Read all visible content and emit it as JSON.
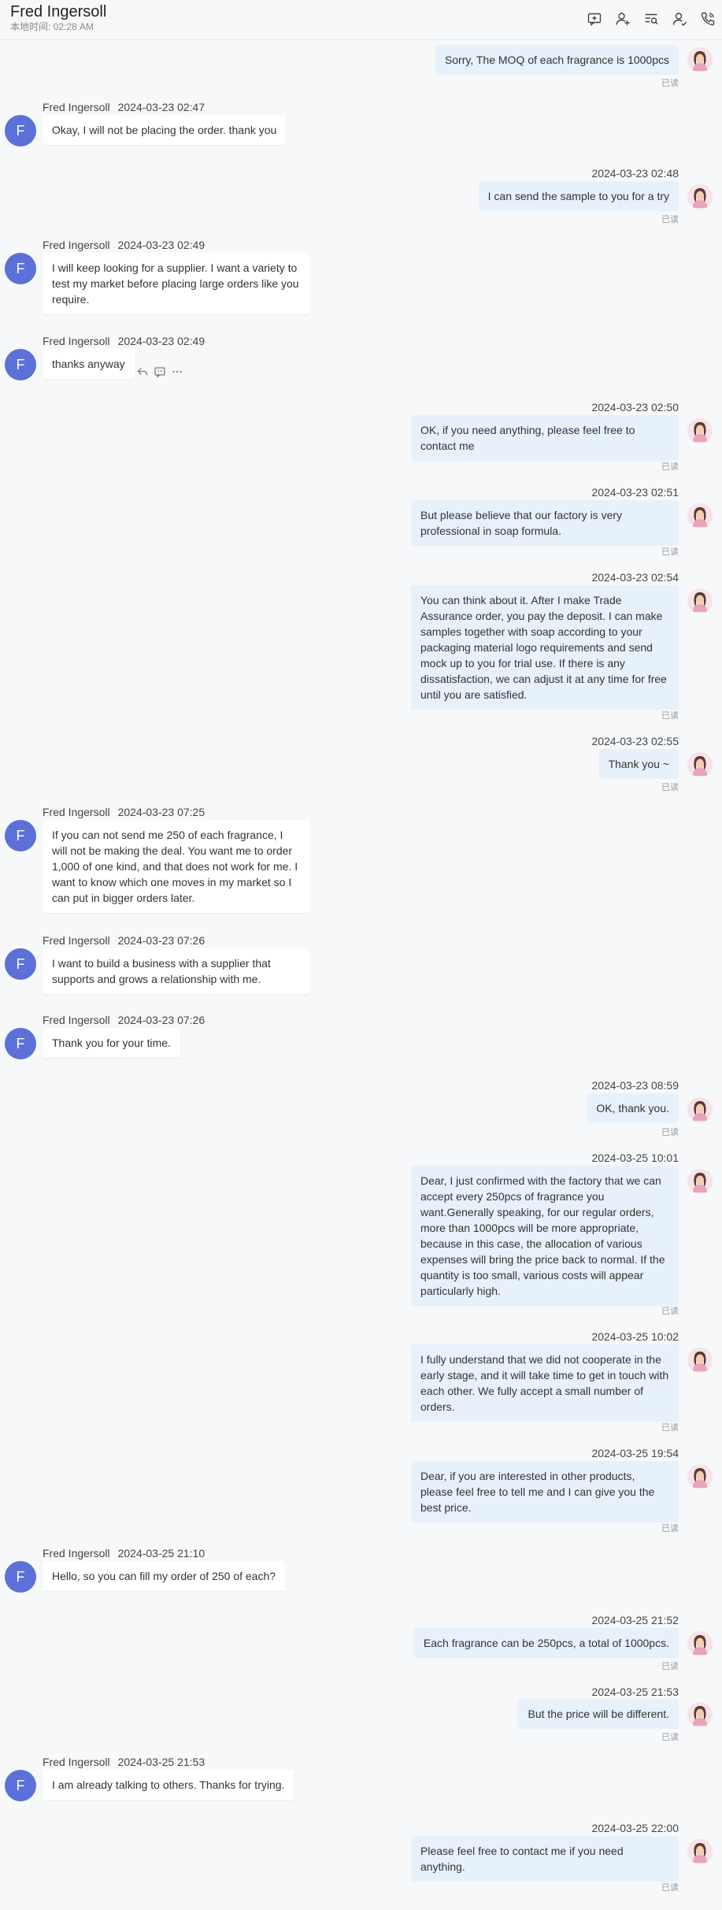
{
  "header": {
    "contact_name": "Fred Ingersoll",
    "local_time": "本地时间: 02:28 AM",
    "icons": [
      "add-message-icon",
      "add-contact-icon",
      "search-messages-icon",
      "user-profile-icon",
      "phone-call-icon"
    ]
  },
  "read_label": "已读",
  "incoming_initial": "F",
  "messages": [
    {
      "dir": "out",
      "time": "",
      "text": "Sorry, The MOQ of each fragrance is 1000pcs"
    },
    {
      "dir": "in",
      "sender": "Fred Ingersoll",
      "time": "2024-03-23 02:47",
      "text": "Okay, I will not be placing the order. thank you"
    },
    {
      "dir": "out",
      "time": "2024-03-23 02:48",
      "text": "I can send the sample to you for a try"
    },
    {
      "dir": "in",
      "sender": "Fred Ingersoll",
      "time": "2024-03-23 02:49",
      "text": "I will keep looking for a supplier. I want a variety to test my market before placing large orders like you require."
    },
    {
      "dir": "in",
      "sender": "Fred Ingersoll",
      "time": "2024-03-23 02:49",
      "text": "thanks anyway"
    },
    {
      "dir": "out",
      "time": "2024-03-23 02:50",
      "text": "OK, if you need anything, please feel free to contact me"
    },
    {
      "dir": "out",
      "time": "2024-03-23 02:51",
      "text": "But please believe that our factory is very professional in soap formula."
    },
    {
      "dir": "out",
      "time": "2024-03-23 02:54",
      "text": "You can think about it. After I make Trade Assurance order, you pay the deposit. I can make samples together with soap according to your packaging material logo requirements and send mock up to you for trial use. If there is any dissatisfaction, we can adjust it at any time for free until you are satisfied."
    },
    {
      "dir": "out",
      "time": "2024-03-23 02:55",
      "text": "Thank you ~"
    },
    {
      "dir": "in",
      "sender": "Fred Ingersoll",
      "time": "2024-03-23 07:25",
      "text": "If you can not send me 250 of each fragrance, I will not be making the deal. You want me to order 1,000 of one kind, and that does not work for me. I want to know which one moves in my market so I can put in bigger orders later."
    },
    {
      "dir": "in",
      "sender": "Fred Ingersoll",
      "time": "2024-03-23 07:26",
      "text": "I want to build a business with a supplier that supports and grows a relationship with me."
    },
    {
      "dir": "in",
      "sender": "Fred Ingersoll",
      "time": "2024-03-23 07:26",
      "text": "Thank you for your time."
    },
    {
      "dir": "out",
      "time": "2024-03-23 08:59",
      "text": "OK, thank you."
    },
    {
      "dir": "out",
      "time": "2024-03-25 10:01",
      "text": "Dear, I just confirmed with the factory that we can accept every 250pcs of fragrance you want.Generally speaking, for our regular orders, more than 1000pcs will be more appropriate, because in this case, the allocation of various expenses will bring the price back to normal. If the quantity is too small, various costs will appear particularly high."
    },
    {
      "dir": "out",
      "time": "2024-03-25 10:02",
      "text": "I fully understand that we did not cooperate in the early stage, and it will take time to get in touch with each other. We fully accept a small number of orders."
    },
    {
      "dir": "out",
      "time": "2024-03-25 19:54",
      "text": "Dear, if you are interested in other products, please feel free to tell me and I can give you the best price."
    },
    {
      "dir": "in",
      "sender": "Fred Ingersoll",
      "time": "2024-03-25 21:10",
      "text": "Hello, so you can fill my order of 250 of each?"
    },
    {
      "dir": "out",
      "time": "2024-03-25 21:52",
      "text": "Each fragrance can be 250pcs, a total of 1000pcs."
    },
    {
      "dir": "out",
      "time": "2024-03-25 21:53",
      "text": "But the price will be different."
    },
    {
      "dir": "in",
      "sender": "Fred Ingersoll",
      "time": "2024-03-25 21:53",
      "text": "I am already talking to others. Thanks for trying."
    },
    {
      "dir": "out",
      "time": "2024-03-25 22:00",
      "text": "Please feel free to contact me if you need anything."
    }
  ],
  "message_tools": [
    "reply-icon",
    "quote-icon",
    "more-icon"
  ],
  "colors": {
    "incoming_avatar": "#5b70d8",
    "outgoing_bubble": "#e6f1fc",
    "incoming_bubble": "#ffffff"
  }
}
